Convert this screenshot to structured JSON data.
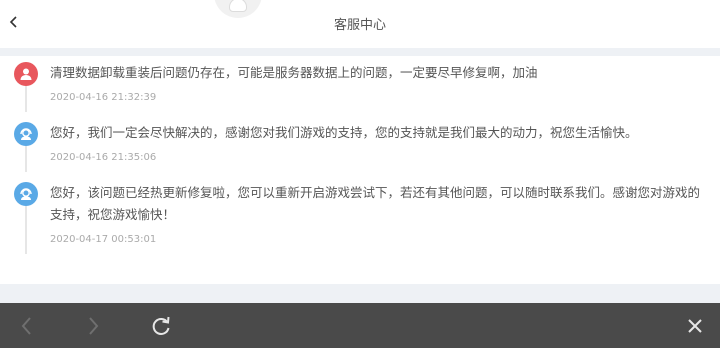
{
  "header": {
    "title": "客服中心"
  },
  "messages": [
    {
      "role": "user",
      "text": "清理数据卸载重装后问题仍存在，可能是服务器数据上的问题，一定要尽早修复啊，加油",
      "time": "2020-04-16 21:32:39"
    },
    {
      "role": "service",
      "text": "您好，我们一定会尽快解决的，感谢您对我们游戏的支持，您的支持就是我们最大的动力，祝您生活愉快。",
      "time": "2020-04-16 21:35:06"
    },
    {
      "role": "service",
      "text": "您好，该问题已经热更新修复啦，您可以重新开启游戏尝试下，若还有其他问题，可以随时联系我们。感谢您对游戏的支持，祝您游戏愉快！",
      "time": "2020-04-17 00:53:01"
    }
  ],
  "colors": {
    "user_dot": "#e8575d",
    "service_dot": "#5aa9e6",
    "toolbar_bg": "#4a4a4a"
  },
  "icons": {
    "back": "chevron-left-icon",
    "nav_back": "arrow-left-icon",
    "nav_forward": "arrow-right-icon",
    "refresh": "refresh-icon",
    "close": "close-icon"
  }
}
